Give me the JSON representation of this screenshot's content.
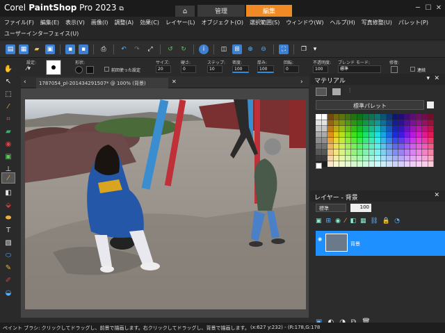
{
  "app": {
    "brand": "Corel",
    "product": "PaintShop",
    "suffix": "Pro 2023"
  },
  "workspace_tabs": [
    {
      "label": "管理"
    },
    {
      "label": "編集"
    }
  ],
  "menu": [
    "ファイル(F)",
    "編集(E)",
    "表示(V)",
    "画像(I)",
    "調整(A)",
    "効果(C)",
    "レイヤー(L)",
    "オブジェクト(O)",
    "選択範囲(S)",
    "ウィンドウ(W)",
    "ヘルプ(H)",
    "写真修整(U)",
    "パレット(P)"
  ],
  "ui_menu": "ユーザーインターフェイス(U)",
  "options": {
    "preset_label": "設定:",
    "shape_label": "形状:",
    "pressure_label": "前回使った設定",
    "size_label": "サイズ:",
    "size_value": "20",
    "hardness_label": "硬さ:",
    "hardness_value": "0",
    "step_label": "ステップ:",
    "step_value": "10",
    "density_label": "密度:",
    "density_value": "100",
    "thickness_label": "厚み:",
    "thickness_value": "100",
    "rotation_label": "回転:",
    "rotation_value": "0",
    "opacity_label": "不透明度:",
    "opacity_value": "100",
    "blend_label": "ブレンド モード:",
    "blend_value": "標準",
    "edge_label": "修復:",
    "stroke_label": "連続"
  },
  "document": {
    "tab_title": "1787054_pl-201434291507* @ 100% (背景)"
  },
  "materials": {
    "title": "マテリアル",
    "palette_select": "標準パレット"
  },
  "layers": {
    "title": "レイヤー - 背景",
    "blend": "標準",
    "opacity": "100",
    "layer_name": "背景"
  },
  "status": {
    "hint": "ペイント ブラシ: クリックしてドラッグし、前景で描画します。右クリックしてドラッグし、背景で描画します。",
    "coords": "(x:627 y:232) - (R:178,G:178"
  },
  "colors": {
    "accent": "#f08a24",
    "selection": "#1e90ff"
  }
}
